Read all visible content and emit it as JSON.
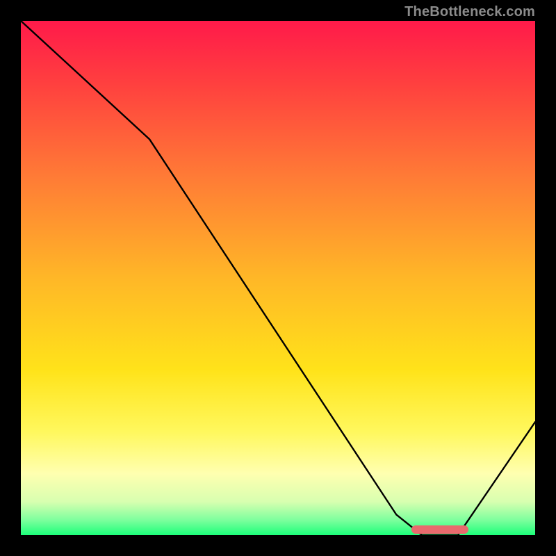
{
  "watermark": "TheBottleneck.com",
  "colors": {
    "frame": "#000000",
    "curve": "#000000",
    "marker": "#e86a6d",
    "watermark": "#8b8b8b",
    "gradient_stops": [
      {
        "offset": 0.0,
        "color": "#ff1a4a"
      },
      {
        "offset": 0.12,
        "color": "#ff3f3f"
      },
      {
        "offset": 0.3,
        "color": "#ff7a36"
      },
      {
        "offset": 0.5,
        "color": "#ffb727"
      },
      {
        "offset": 0.68,
        "color": "#ffe31a"
      },
      {
        "offset": 0.8,
        "color": "#fff85e"
      },
      {
        "offset": 0.88,
        "color": "#ffffb0"
      },
      {
        "offset": 0.935,
        "color": "#d8ffb0"
      },
      {
        "offset": 0.97,
        "color": "#7fff9e"
      },
      {
        "offset": 1.0,
        "color": "#1cff7a"
      }
    ]
  },
  "chart_data": {
    "type": "line",
    "title": "",
    "xlabel": "",
    "ylabel": "",
    "xlim": [
      0,
      100
    ],
    "ylim": [
      0,
      100
    ],
    "series": [
      {
        "name": "bottleneck-curve",
        "x": [
          0,
          25,
          73,
          78,
          85,
          100
        ],
        "y": [
          100,
          77,
          4,
          0,
          0,
          22
        ]
      }
    ],
    "annotations": [
      {
        "name": "optimal-range-marker",
        "x_start": 76,
        "x_end": 87,
        "y": 0
      }
    ],
    "background": "vertical-gradient red→orange→yellow→green (top→bottom)"
  }
}
